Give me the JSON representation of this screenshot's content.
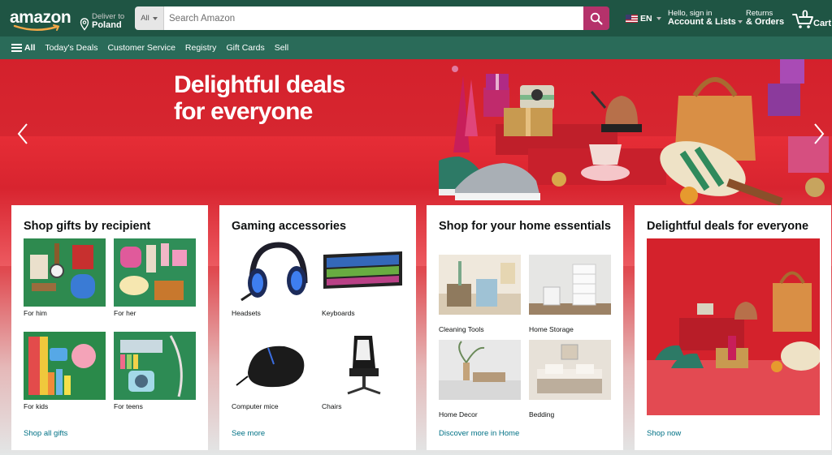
{
  "header": {
    "logo": "amazon",
    "deliver_line1": "Deliver to",
    "deliver_line2": "Poland",
    "search_category": "All",
    "search_placeholder": "Search Amazon",
    "language": "EN",
    "account_line1": "Hello, sign in",
    "account_line2": "Account & Lists",
    "returns_line1": "Returns",
    "returns_line2": "& Orders",
    "cart_count": "0",
    "cart_label": "Cart"
  },
  "subnav": {
    "all_label": "All",
    "links": [
      "Today's Deals",
      "Customer Service",
      "Registry",
      "Gift Cards",
      "Sell"
    ]
  },
  "hero": {
    "title_line1": "Delightful deals",
    "title_line2": "for everyone"
  },
  "cards": [
    {
      "title": "Shop gifts by recipient",
      "tiles": [
        "For him",
        "For her",
        "For kids",
        "For teens"
      ],
      "link": "Shop all gifts"
    },
    {
      "title": "Gaming accessories",
      "tiles": [
        "Headsets",
        "Keyboards",
        "Computer mice",
        "Chairs"
      ],
      "link": "See more"
    },
    {
      "title": "Shop for your home essentials",
      "tiles": [
        "Cleaning Tools",
        "Home Storage",
        "Home Decor",
        "Bedding"
      ],
      "link": "Discover more in Home"
    },
    {
      "title": "Delightful deals for everyone",
      "link": "Shop now"
    }
  ],
  "colors": {
    "nav_top": "#1f5544",
    "nav_sub": "#2a6b59",
    "search_button": "#b5326b",
    "hero_red": "#d4212c",
    "link": "#007185"
  }
}
